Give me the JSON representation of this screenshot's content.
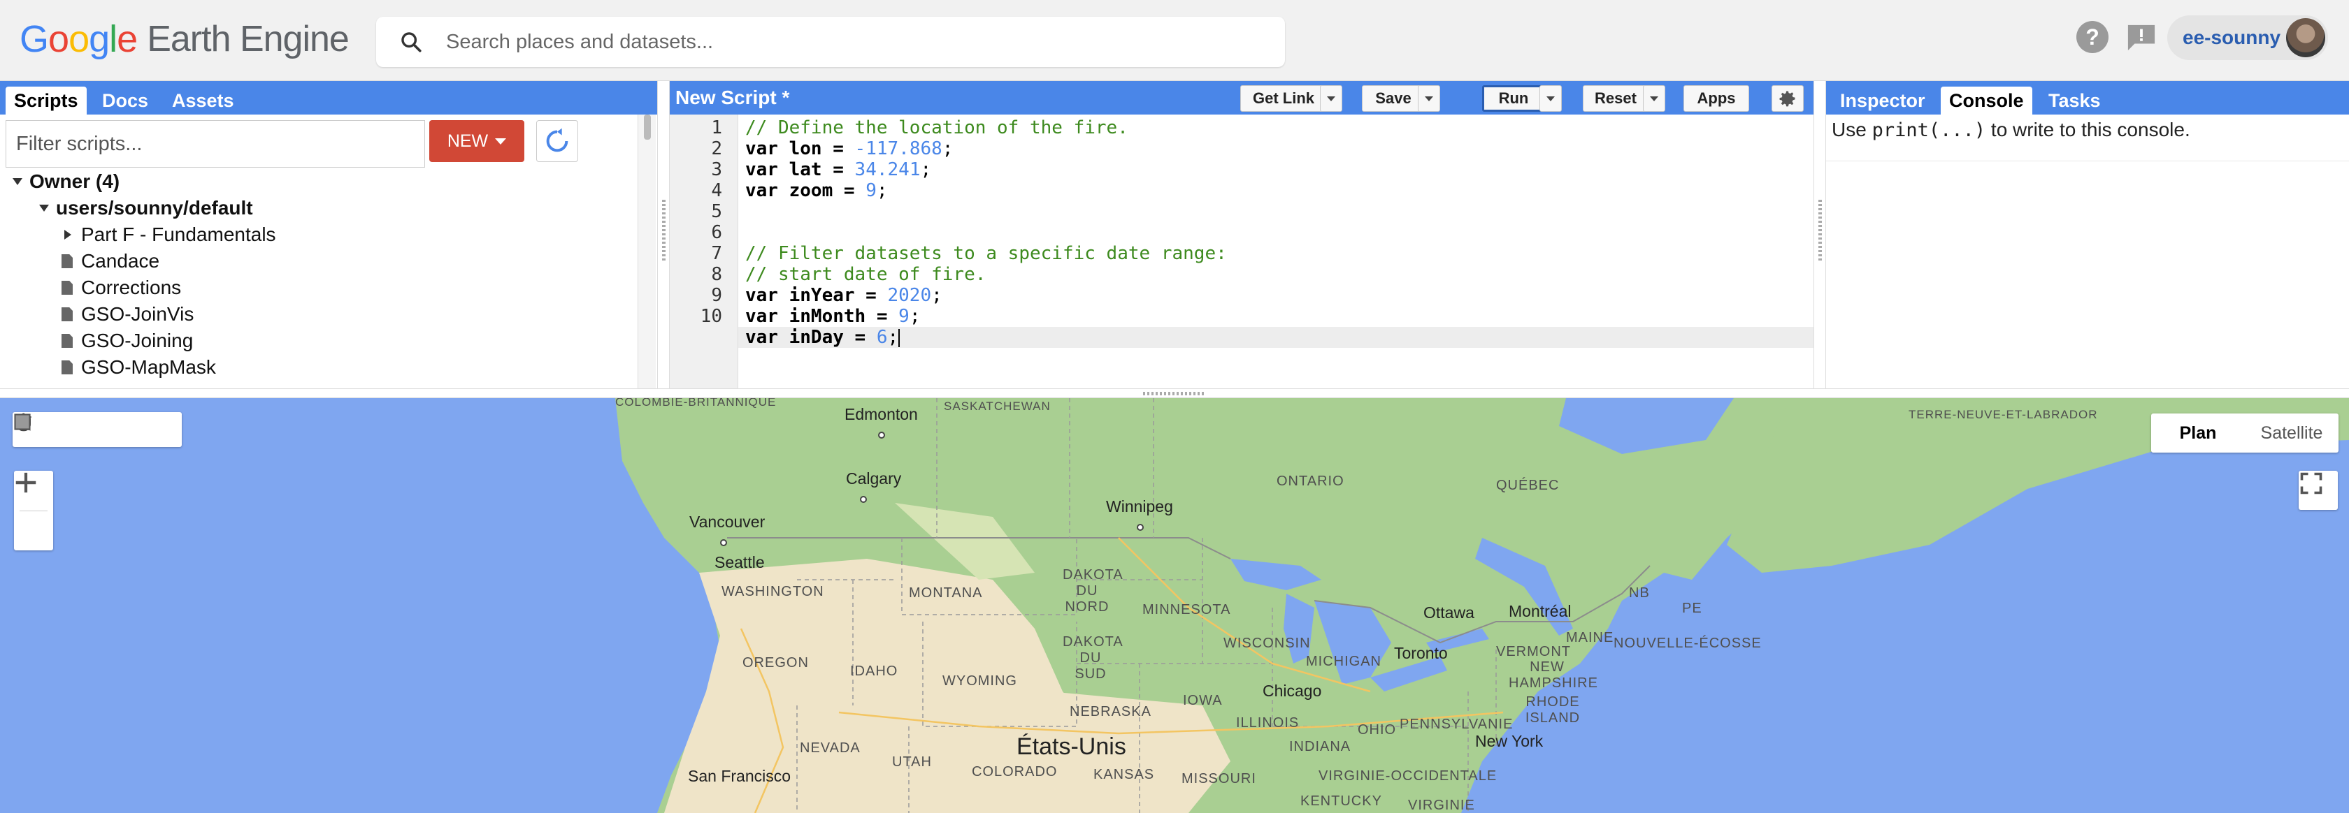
{
  "header": {
    "logo_google": [
      "G",
      "o",
      "o",
      "g",
      "l",
      "e"
    ],
    "logo_product": "Earth Engine",
    "search_placeholder": "Search places and datasets...",
    "account_name": "ee-sounny"
  },
  "left_panel": {
    "tabs": [
      "Scripts",
      "Docs",
      "Assets"
    ],
    "active_tab": "Scripts",
    "filter_placeholder": "Filter scripts...",
    "new_button": "NEW",
    "tree": {
      "owner": "Owner (4)",
      "repo": "users/sounny/default",
      "folder": "Part F - Fundamentals",
      "files": [
        "Candace",
        "Corrections",
        "GSO-JoinVis",
        "GSO-Joining",
        "GSO-MapMask"
      ]
    }
  },
  "editor": {
    "title": "New Script *",
    "buttons": {
      "get_link": "Get Link",
      "save": "Save",
      "run": "Run",
      "reset": "Reset",
      "apps": "Apps"
    },
    "line_numbers": [
      "1",
      "2",
      "3",
      "4",
      "5",
      "6",
      "7",
      "8",
      "9",
      "10"
    ],
    "code": {
      "l1": "// Define the location of the fire.",
      "l2_kw": "var lon = ",
      "l2_num": "-117.868",
      "l2_end": ";",
      "l3_kw": "var lat = ",
      "l3_num": "34.241",
      "l3_end": ";",
      "l4_kw": "var zoom = ",
      "l4_num": "9",
      "l4_end": ";",
      "l6": "// Filter datasets to a specific date range:",
      "l7": "// start date of fire.",
      "l8_kw": "var inYear = ",
      "l8_num": "2020",
      "l8_end": ";",
      "l9_kw": "var inMonth = ",
      "l9_num": "9",
      "l9_end": ";",
      "l10_kw": "var inDay = ",
      "l10_num": "6",
      "l10_end": ";"
    }
  },
  "right_panel": {
    "tabs": [
      "Inspector",
      "Console",
      "Tasks"
    ],
    "active_tab": "Console",
    "console_pre": "Use ",
    "console_code": "print(...)",
    "console_post": " to write to this console."
  },
  "map": {
    "map_types": [
      "Plan",
      "Satellite"
    ],
    "active_map_type": "Plan",
    "country": "États-Unis",
    "cities": [
      "Edmonton",
      "Calgary",
      "Vancouver",
      "Seattle",
      "Winnipeg",
      "Ottawa",
      "Montréal",
      "Toronto",
      "Chicago",
      "New York",
      "San Francisco"
    ],
    "regions": [
      "COLOMBIE-BRITANNIQUE",
      "SASKATCHEWAN",
      "TERRE-NEUVE-ET-LABRADOR",
      "ONTARIO",
      "QUÉBEC",
      "WASHINGTON",
      "MONTANA",
      "DAKOTA DU NORD",
      "MINNESOTA",
      "NB",
      "PE",
      "OREGON",
      "IDAHO",
      "WYOMING",
      "DAKOTA DU SUD",
      "WISCONSIN",
      "MICHIGAN",
      "MAINE",
      "NOUVELLE-ÉCOSSE",
      "VERMONT",
      "NEW HAMPSHIRE",
      "NEBRASKA",
      "IOWA",
      "RHODE ISLAND",
      "NEVADA",
      "UTAH",
      "COLORADO",
      "KANSAS",
      "ILLINOIS",
      "INDIANA",
      "OHIO",
      "PENNSYLVANIE",
      "MISSOURI",
      "VIRGINIE-OCCIDENTALE",
      "KENTUCKY",
      "VIRGINIE"
    ]
  },
  "colors": {
    "panel_blue": "#4a86e8",
    "new_red": "#d14836",
    "water": "#7fa6f0",
    "land_green": "#a9cf92",
    "comment_green": "#3d8a1e",
    "number_blue": "#4a86e8"
  }
}
